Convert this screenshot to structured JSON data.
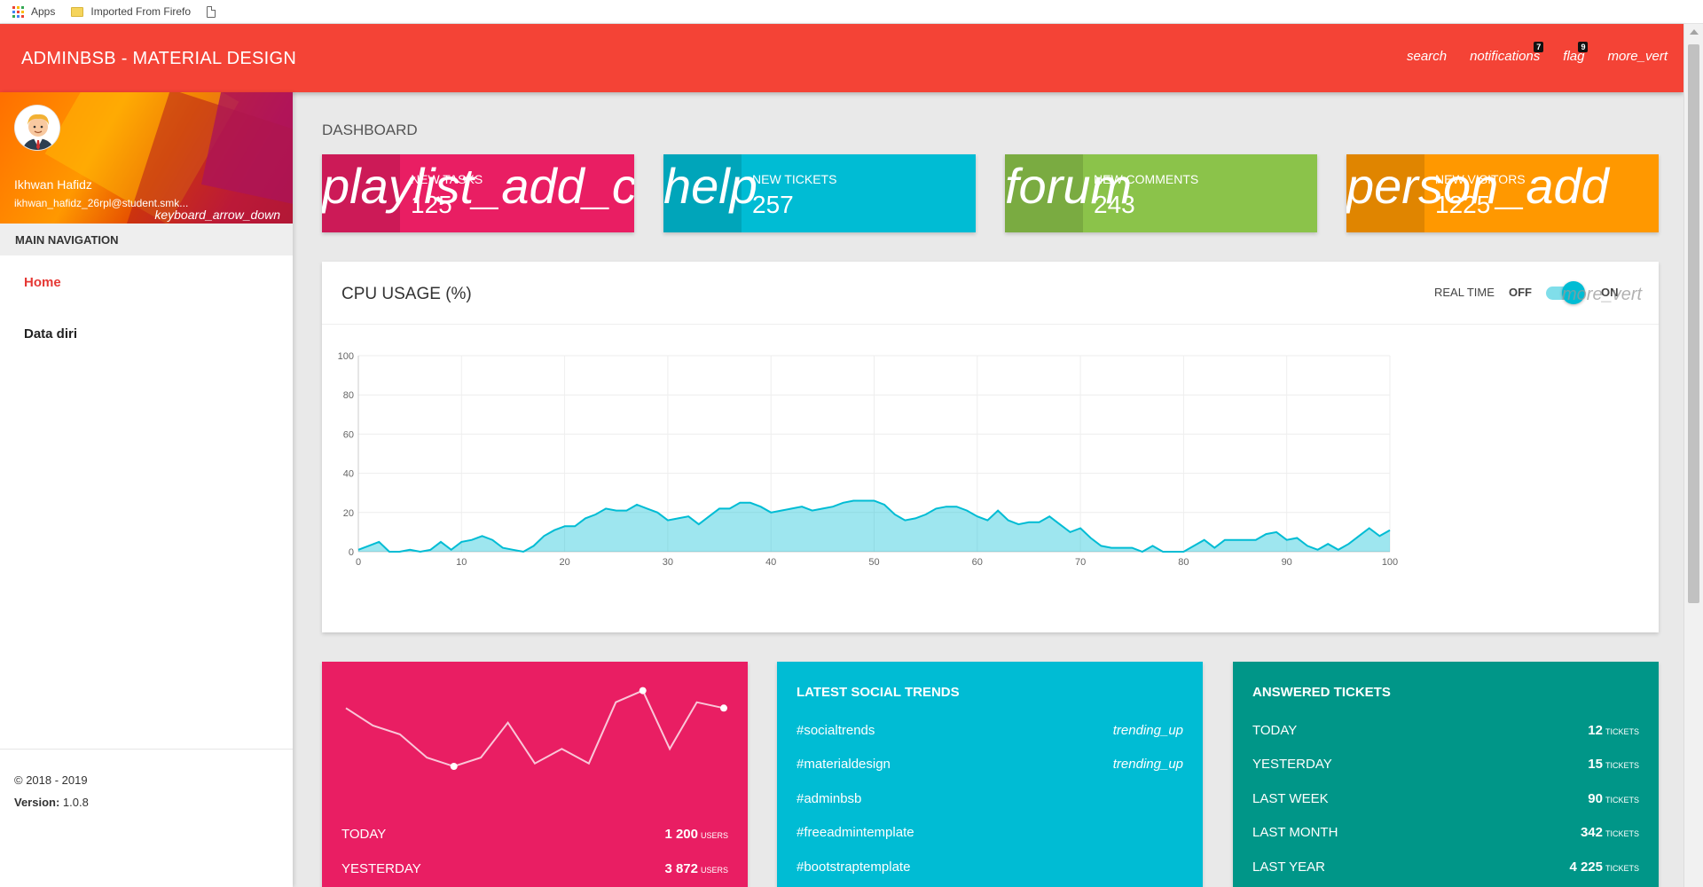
{
  "bookmarks": [
    {
      "label": "Apps",
      "icon": "apps-grid-icon"
    },
    {
      "label": "Imported From Firefo",
      "icon": "folder-icon"
    },
    {
      "label": "",
      "icon": "page-icon"
    }
  ],
  "colors": {
    "topbar": "#f44336",
    "pink": "#e91e63",
    "cyan": "#00bcd4",
    "lightgreen": "#8bc34a",
    "orange": "#ff9800",
    "teal": "#009688",
    "nav_active": "#e53935"
  },
  "topbar": {
    "brand": "ADMINBSB - MATERIAL DESIGN",
    "actions": {
      "search": "search",
      "notifications": "notifications",
      "notifications_count": "7",
      "flag": "flag",
      "flag_count": "9",
      "more": "more_vert"
    }
  },
  "sidebar": {
    "user": {
      "name": "Ikhwan Hafidz",
      "email": "ikhwan_hafidz_26rpl@student.smk...",
      "menu_icon": "keyboard_arrow_down"
    },
    "nav_header": "MAIN NAVIGATION",
    "items": [
      {
        "label": "Home",
        "active": true
      },
      {
        "label": "Data diri",
        "active": false
      }
    ],
    "legal": {
      "copyright": "© 2018 - 2019",
      "version_label": "Version:",
      "version": "1.0.8"
    }
  },
  "main": {
    "title": "DASHBOARD",
    "info_boxes": [
      {
        "icon": "playlist_add_check",
        "label": "NEW TASKS",
        "value": "125"
      },
      {
        "icon": "help",
        "label": "NEW TICKETS",
        "value": "257"
      },
      {
        "icon": "forum",
        "label": "NEW COMMENTS",
        "value": "243"
      },
      {
        "icon": "person_add",
        "label": "NEW VISITORS",
        "value": "1225"
      }
    ],
    "cpu": {
      "title": "CPU USAGE (%)",
      "realtime_label": "REAL TIME",
      "off_label": "OFF",
      "on_label": "ON",
      "realtime_on": true,
      "more_icon": "more_vert"
    },
    "visitors_card": {
      "rows": [
        {
          "label": "TODAY",
          "value": "1 200",
          "unit": "USERS"
        },
        {
          "label": "YESTERDAY",
          "value": "3 872",
          "unit": "USERS"
        }
      ],
      "sparkline": [
        10,
        7,
        5.5,
        1.5,
        0,
        1.5,
        7.5,
        0.5,
        3,
        0.5,
        11,
        13,
        3,
        11,
        10
      ]
    },
    "trends_card": {
      "title": "LATEST SOCIAL TRENDS",
      "items": [
        {
          "tag": "#socialtrends",
          "icon": "trending_up"
        },
        {
          "tag": "#materialdesign",
          "icon": "trending_up"
        },
        {
          "tag": "#adminbsb",
          "icon": ""
        },
        {
          "tag": "#freeadmintemplate",
          "icon": ""
        },
        {
          "tag": "#bootstraptemplate",
          "icon": ""
        }
      ]
    },
    "tickets_card": {
      "title": "ANSWERED TICKETS",
      "rows": [
        {
          "label": "TODAY",
          "value": "12",
          "unit": "TICKETS"
        },
        {
          "label": "YESTERDAY",
          "value": "15",
          "unit": "TICKETS"
        },
        {
          "label": "LAST WEEK",
          "value": "90",
          "unit": "TICKETS"
        },
        {
          "label": "LAST MONTH",
          "value": "342",
          "unit": "TICKETS"
        },
        {
          "label": "LAST YEAR",
          "value": "4 225",
          "unit": "TICKETS"
        }
      ]
    }
  },
  "chart_data": {
    "type": "area",
    "title": "CPU USAGE (%)",
    "xlabel": "",
    "ylabel": "",
    "xlim": [
      0,
      100
    ],
    "ylim": [
      0,
      100
    ],
    "x_ticks": [
      0,
      10,
      20,
      30,
      40,
      50,
      60,
      70,
      80,
      90,
      100
    ],
    "y_ticks": [
      0,
      20,
      40,
      60,
      80,
      100
    ],
    "grid": true,
    "color": "#00bcd4",
    "x": [
      0,
      1,
      2,
      3,
      4,
      5,
      6,
      7,
      8,
      9,
      10,
      11,
      12,
      13,
      14,
      15,
      16,
      17,
      18,
      19,
      20,
      21,
      22,
      23,
      24,
      25,
      26,
      27,
      28,
      29,
      30,
      31,
      32,
      33,
      34,
      35,
      36,
      37,
      38,
      39,
      40,
      41,
      42,
      43,
      44,
      45,
      46,
      47,
      48,
      49,
      50,
      51,
      52,
      53,
      54,
      55,
      56,
      57,
      58,
      59,
      60,
      61,
      62,
      63,
      64,
      65,
      66,
      67,
      68,
      69,
      70,
      71,
      72,
      73,
      74,
      75,
      76,
      77,
      78,
      79,
      80,
      81,
      82,
      83,
      84,
      85,
      86,
      87,
      88,
      89,
      90,
      91,
      92,
      93,
      94,
      95,
      96,
      97,
      98,
      99,
      100
    ],
    "values": [
      1,
      3,
      5,
      0,
      0,
      1,
      0,
      1,
      5,
      1,
      5,
      6,
      8,
      6,
      2,
      1,
      0,
      3,
      8,
      11,
      13,
      13,
      17,
      19,
      22,
      21,
      21,
      24,
      22,
      20,
      16,
      17,
      18,
      14,
      18,
      22,
      22,
      25,
      25,
      23,
      20,
      21,
      22,
      23,
      21,
      22,
      23,
      25,
      26,
      26,
      26,
      24,
      19,
      16,
      17,
      19,
      22,
      23,
      23,
      21,
      18,
      16,
      21,
      16,
      14,
      15,
      15,
      18,
      14,
      10,
      12,
      7,
      3,
      2,
      2,
      2,
      0,
      3,
      0,
      0,
      0,
      3,
      6,
      2,
      6,
      6,
      6,
      6,
      9,
      10,
      6,
      7,
      3,
      1,
      4,
      1,
      4,
      8,
      12,
      8,
      11
    ]
  }
}
